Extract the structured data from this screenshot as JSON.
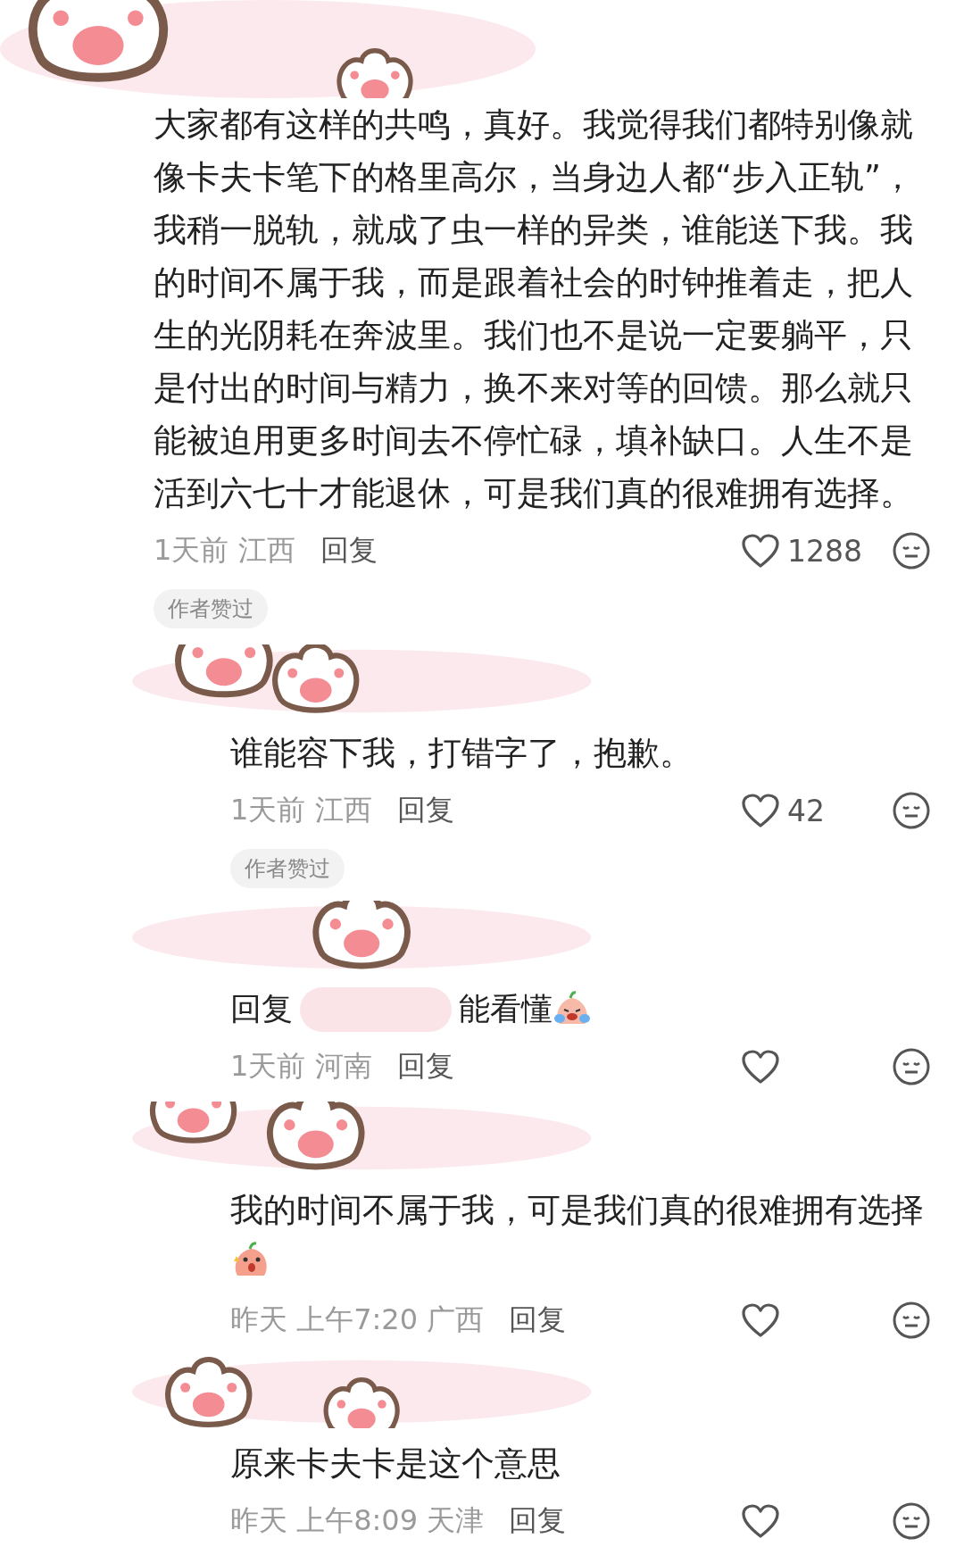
{
  "comment": {
    "text": "大家都有这样的共鸣，真好。我觉得我们都特别像就像卡夫卡笔下的格里高尔，当身边人都“步入正轨”，我稍一脱轨，就成了虫一样的异类，谁能送下我。我的时间不属于我，而是跟着社会的时钟推着走，把人生的光阴耗在奔波里。我们也不是说一定要躺平，只是付出的时间与精力，换不来对等的回馈。那么就只能被迫用更多时间去不停忙碌，填补缺口。人生不是活到六七十才能退休，可是我们真的很难拥有选择。",
    "time": "1天前 江西",
    "reply_label": "回复",
    "likes": "1288",
    "badge": "作者赞过"
  },
  "replies": [
    {
      "text": "谁能容下我，打错字了，抱歉。",
      "time": "1天前 江西",
      "reply_label": "回复",
      "likes": "42",
      "badge": "作者赞过"
    },
    {
      "reply_to": "回复",
      "text": "能看懂",
      "emoji": {
        "kind": "crying"
      },
      "time": "1天前 河南",
      "reply_label": "回复"
    },
    {
      "text": "我的时间不属于我，可是我们真的很难拥有选择",
      "emoji": {
        "kind": "shouting"
      },
      "time": "昨天 上午7:20 广西",
      "reply_label": "回复"
    },
    {
      "text": "原来卡夫卡是这个意思",
      "time": "昨天 上午8:09 天津",
      "reply_label": "回复"
    }
  ]
}
